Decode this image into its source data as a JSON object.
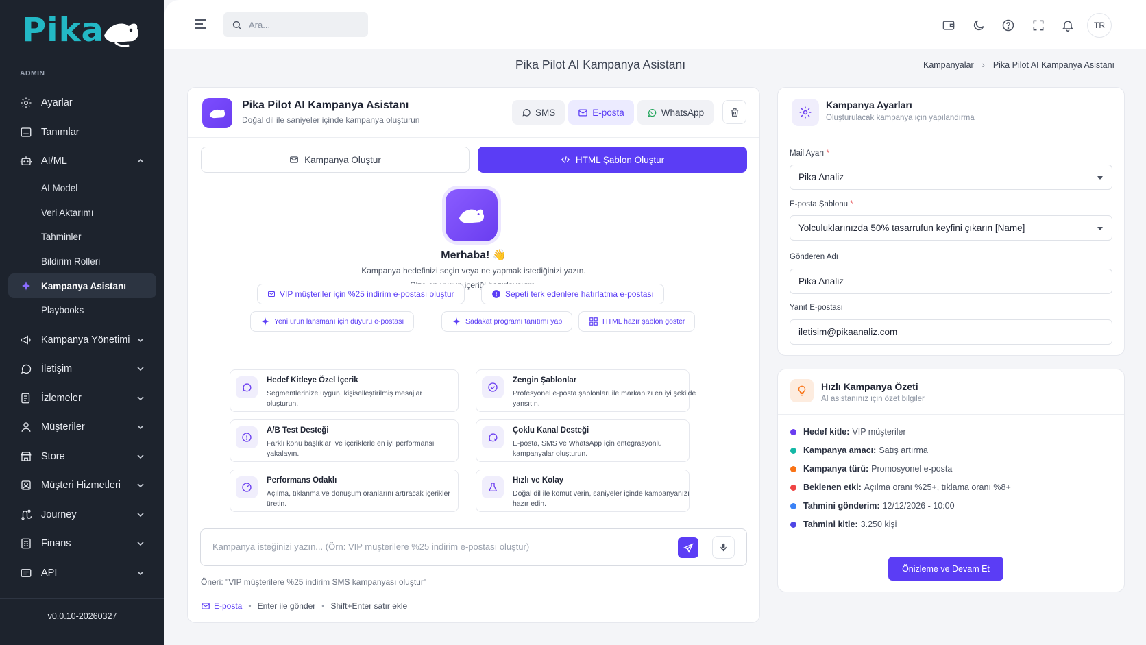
{
  "sidebar": {
    "logo_text": "Pika",
    "section_label": "ADMIN",
    "items": [
      {
        "label": "Ayarlar",
        "icon": "gear-icon"
      },
      {
        "label": "Tanımlar",
        "icon": "box-icon"
      },
      {
        "label": "AI/ML",
        "icon": "robot-icon"
      }
    ],
    "ai_sub": [
      "AI Model",
      "Veri Aktarımı",
      "Tahminler",
      "Bildirim Rolleri",
      "Kampanya Asistanı",
      "Playbooks"
    ],
    "items2": [
      {
        "label": "Kampanya Yönetimi",
        "icon": "megaphone-icon"
      },
      {
        "label": "İletişim",
        "icon": "chat-icon"
      },
      {
        "label": "İzlemeler",
        "icon": "report-icon"
      },
      {
        "label": "Müşteriler",
        "icon": "user-icon"
      },
      {
        "label": "Store",
        "icon": "store-icon"
      },
      {
        "label": "Müşteri Hizmetleri",
        "icon": "support-icon"
      },
      {
        "label": "Journey",
        "icon": "route-icon"
      },
      {
        "label": "Finans",
        "icon": "finance-icon"
      },
      {
        "label": "API",
        "icon": "api-icon"
      }
    ],
    "version": "v0.0.10-20260327"
  },
  "topbar": {
    "search_placeholder": "Ara...",
    "lang": "TR"
  },
  "page": {
    "title": "Pika Pilot AI Kampanya Asistanı",
    "breadcrumb": [
      "Kampanyalar",
      "Pika Pilot AI Kampanya Asistanı"
    ]
  },
  "chat": {
    "title": "Pika Pilot AI Kampanya Asistanı",
    "subtitle": "Doğal dil ile saniyeler içinde kampanya oluşturun",
    "channels": [
      "SMS",
      "E-posta",
      "WhatsApp"
    ],
    "active_channel": "E-posta",
    "tabs": [
      "Kampanya Oluştur",
      "HTML Şablon Oluştur"
    ],
    "hello": "Merhaba! 👋",
    "intro1": "Kampanya hedefinizi seçin veya ne yapmak istediğinizi yazın.",
    "intro2": "Size en uygun içeriği hazırlayayım.",
    "chips": [
      "VIP müşteriler için %25 indirim e-postası oluştur",
      "Sepeti terk edenlere hatırlatma e-postası",
      "Yeni ürün lansmanı için duyuru e-postası",
      "Sadakat programı tanıtımı yap",
      "HTML hazır şablon göster"
    ],
    "features": [
      {
        "title": "Hedef Kitleye Özel İçerik",
        "desc": "Segmentlerinize uygun, kişiselleştirilmiş mesajlar oluşturun."
      },
      {
        "title": "Zengin Şablonlar",
        "desc": "Profesyonel e-posta şablonları ile markanızı en iyi şekilde yansıtın."
      },
      {
        "title": "A/B Test Desteği",
        "desc": "Farklı konu başlıkları ve içeriklerle en iyi performansı yakalayın."
      },
      {
        "title": "Çoklu Kanal Desteği",
        "desc": "E-posta, SMS ve WhatsApp için entegrasyonlu kampanyalar oluşturun."
      },
      {
        "title": "Performans Odaklı",
        "desc": "Açılma, tıklanma ve dönüşüm oranlarını artıracak içerikler üretin."
      },
      {
        "title": "Hızlı ve Kolay",
        "desc": "Doğal dil ile komut verin, saniyeler içinde kampanyanızı hazır edin."
      }
    ],
    "prompt_placeholder": "Kampanya isteğinizi yazın... (Örn: VIP müşterilere %25 indirim e-postası oluştur)",
    "suggestion_label": "Öneri:",
    "suggestion_text": "\"VIP müşterilere %25 indirim SMS kampanyası oluştur\"",
    "footer_channel": "E-posta",
    "footer_hint1": "Enter ile gönder",
    "footer_hint2": "Shift+Enter satır ekle"
  },
  "settings": {
    "title": "Kampanya Ayarları",
    "subtitle": "Oluşturulacak kampanya için yapılandırma",
    "mail_label": "Mail Ayarı",
    "mail_value": "Pika Analiz",
    "template_label": "E-posta Şablonu",
    "template_value": "Yolculuklarınızda 50% tasarrufun keyfini çıkarın [Name]",
    "sender_label": "Gönderen Adı",
    "sender_value": "Pika Analiz",
    "reply_label": "Yanıt E-postası",
    "reply_value": "iletisim@pikaanaliz.com",
    "required_mark": "*"
  },
  "summary": {
    "title": "Hızlı Kampanya Özeti",
    "subtitle": "AI asistanınız için özet bilgiler",
    "rows": [
      {
        "key": "Hedef kitle:",
        "value": "VIP müşteriler",
        "color": "#6a3df0"
      },
      {
        "key": "Kampanya amacı:",
        "value": "Satış artırma",
        "color": "#14b8a6"
      },
      {
        "key": "Kampanya türü:",
        "value": "Promosyonel e-posta",
        "color": "#f97316"
      },
      {
        "key": "Beklenen etki:",
        "value": "Açılma oranı %25+, tıklama oranı %8+",
        "color": "#ef4444"
      },
      {
        "key": "Tahmini gönderim:",
        "value": "12/12/2026 - 10:00",
        "color": "#3b82f6"
      },
      {
        "key": "Tahmini kitle:",
        "value": "3.250 kişi",
        "color": "#4f46e5"
      }
    ],
    "button": "Önizleme ve Devam Et"
  }
}
